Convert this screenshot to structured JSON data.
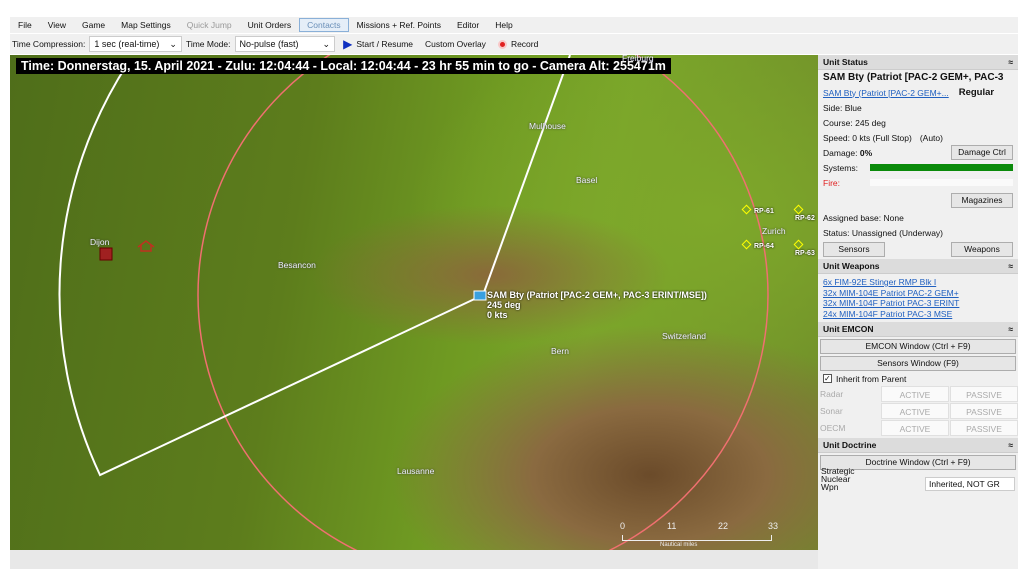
{
  "menu": [
    "File",
    "View",
    "Game",
    "Map Settings",
    "Quick Jump",
    "Unit Orders",
    "Contacts",
    "Missions + Ref. Points",
    "Editor",
    "Help"
  ],
  "toolbar": {
    "time_compression_label": "Time Compression:",
    "time_compression_value": "1 sec (real-time)",
    "time_mode_label": "Time Mode:",
    "time_mode_value": "No-pulse (fast)",
    "start_label": "Start / Resume",
    "overlay_label": "Custom Overlay",
    "record_label": "Record"
  },
  "map": {
    "timebar": "Time: Donnerstag, 15. April 2021 - Zulu: 12:04:44 - Local: 12:04:44 - 23 hr 55 min to go - Camera Alt: 255471m",
    "cities": [
      "Freiburg",
      "Mulhouse",
      "Basel",
      "Dijon",
      "Besancon",
      "Zurich",
      "Bern",
      "Switzerland",
      "Lausanne"
    ],
    "ref_points": [
      "RP-61",
      "RP-62",
      "RP-64",
      "RP-63"
    ],
    "unit": {
      "name": "SAM Bty (Patriot [PAC-2 GEM+, PAC-3 ERINT/MSE])",
      "course": "245 deg",
      "speed": "0 kts"
    },
    "scale_ticks": [
      "0",
      "11",
      "22",
      "33"
    ],
    "scale_unit": "Nautical miles"
  },
  "panel": {
    "status_title": "Unit Status",
    "unit_name": "SAM Bty (Patriot [PAC-2 GEM+, PAC-3",
    "unit_link": "SAM Bty (Patriot [PAC-2 GEM+...",
    "proficiency": "Regular",
    "side": "Side: Blue",
    "course": "Course: 245 deg",
    "speed": "Speed: 0 kts (Full Stop)",
    "speed_mode": "(Auto)",
    "damage_label": "Damage:",
    "damage_value": "0%",
    "damage_ctrl": "Damage Ctrl",
    "systems_label": "Systems:",
    "systems_pct": 100,
    "fire_label": "Fire:",
    "fire_pct": 0,
    "magazines": "Magazines",
    "base": "Assigned base: None",
    "status": "Status: Unassigned (Underway)",
    "sensors": "Sensors",
    "weapons": "Weapons",
    "weapons_title": "Unit Weapons",
    "weapon_list": [
      "6x FIM-92E Stinger RMP Blk I",
      "32x MIM-104E Patriot PAC-2 GEM+",
      "32x MIM-104F Patriot PAC-3 ERINT",
      "24x MIM-104F Patriot PAC-3 MSE"
    ],
    "emcon_title": "Unit EMCON",
    "emcon_window": "EMCON Window (Ctrl + F9)",
    "sensors_window": "Sensors Window (F9)",
    "inherit": "Inherit from Parent",
    "emcon_rows": [
      {
        "label": "Radar",
        "a": "ACTIVE",
        "p": "PASSIVE"
      },
      {
        "label": "Sonar",
        "a": "ACTIVE",
        "p": "PASSIVE"
      },
      {
        "label": "OECM",
        "a": "ACTIVE",
        "p": "PASSIVE"
      }
    ],
    "doctrine_title": "Unit Doctrine",
    "doctrine_window": "Doctrine Window (Ctrl + F9)",
    "nuclear_label": "Strategic Nuclear Wpn",
    "nuclear_value": "Inherited, NOT GR"
  },
  "colors": {
    "systems_bar": "#0a8a0a",
    "fire_label": "#e02020",
    "range_ring": "#f07070"
  }
}
